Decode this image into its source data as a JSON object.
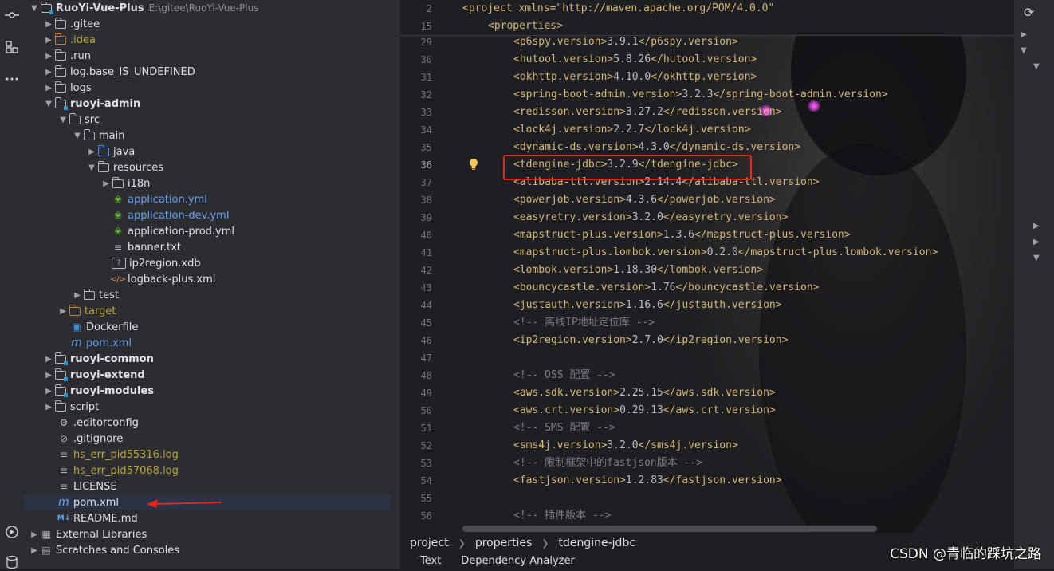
{
  "project": {
    "root_name": "RuoYi-Vue-Plus",
    "root_path": "E:\\gitee\\RuoYi-Vue-Plus",
    "rows": [
      {
        "label": "RuoYi-Vue-Plus",
        "kind": "root"
      },
      {
        "label": ".gitee"
      },
      {
        "label": ".idea"
      },
      {
        "label": ".run"
      },
      {
        "label": "log.base_IS_UNDEFINED"
      },
      {
        "label": "logs"
      },
      {
        "label": "ruoyi-admin"
      },
      {
        "label": "src"
      },
      {
        "label": "main"
      },
      {
        "label": "java"
      },
      {
        "label": "resources"
      },
      {
        "label": "i18n"
      },
      {
        "label": "application.yml"
      },
      {
        "label": "application-dev.yml"
      },
      {
        "label": "application-prod.yml"
      },
      {
        "label": "banner.txt"
      },
      {
        "label": "ip2region.xdb"
      },
      {
        "label": "logback-plus.xml"
      },
      {
        "label": "test"
      },
      {
        "label": "target"
      },
      {
        "label": "Dockerfile"
      },
      {
        "label": "pom.xml"
      },
      {
        "label": "ruoyi-common"
      },
      {
        "label": "ruoyi-extend"
      },
      {
        "label": "ruoyi-modules"
      },
      {
        "label": "script"
      },
      {
        "label": ".editorconfig"
      },
      {
        "label": ".gitignore"
      },
      {
        "label": "hs_err_pid55316.log"
      },
      {
        "label": "hs_err_pid57068.log"
      },
      {
        "label": "LICENSE"
      },
      {
        "label": "pom.xml"
      },
      {
        "label": "README.md"
      },
      {
        "label": "External Libraries"
      },
      {
        "label": "Scratches and Consoles"
      }
    ]
  },
  "editor": {
    "sticky": [
      {
        "line": "2",
        "text": "<project xmlns=\"http://maven.apache.org/POM/4.0.0\""
      },
      {
        "line": "15",
        "text": "<properties>"
      }
    ],
    "lines": [
      {
        "n": "29",
        "pre": "<",
        "tag": "p6spy.version",
        "val": "3.9.1"
      },
      {
        "n": "30",
        "tag": "hutool.version",
        "val": "5.8.26"
      },
      {
        "n": "31",
        "tag": "okhttp.version",
        "val": "4.10.0"
      },
      {
        "n": "32",
        "tag": "spring-boot-admin.version",
        "val": "3.2.3"
      },
      {
        "n": "33",
        "tag": "redisson.version",
        "val": "3.27.2"
      },
      {
        "n": "34",
        "tag": "lock4j.version",
        "val": "2.2.7"
      },
      {
        "n": "35",
        "tag": "dynamic-ds.version",
        "val": "4.3.0"
      },
      {
        "n": "36",
        "tag": "tdengine-jdbc",
        "val": "3.2.9"
      },
      {
        "n": "37",
        "tag": "alibaba-ttl.version",
        "val": "2.14.4"
      },
      {
        "n": "38",
        "tag": "powerjob.version",
        "val": "4.3.6"
      },
      {
        "n": "39",
        "tag": "easyretry.version",
        "val": "3.2.0"
      },
      {
        "n": "40",
        "tag": "mapstruct-plus.version",
        "val": "1.3.6"
      },
      {
        "n": "41",
        "tag": "mapstruct-plus.lombok.version",
        "val": "0.2.0"
      },
      {
        "n": "42",
        "tag": "lombok.version",
        "val": "1.18.30"
      },
      {
        "n": "43",
        "tag": "bouncycastle.version",
        "val": "1.76"
      },
      {
        "n": "44",
        "tag": "justauth.version",
        "val": "1.16.6"
      },
      {
        "n": "45",
        "comment": "<!-- 离线IP地址定位库 -->"
      },
      {
        "n": "46",
        "tag": "ip2region.version",
        "val": "2.7.0"
      },
      {
        "n": "47",
        "blank": true
      },
      {
        "n": "48",
        "comment": "<!-- OSS 配置 -->"
      },
      {
        "n": "49",
        "tag": "aws.sdk.version",
        "val": "2.25.15"
      },
      {
        "n": "50",
        "tag": "aws.crt.version",
        "val": "0.29.13"
      },
      {
        "n": "51",
        "comment": "<!-- SMS 配置 -->"
      },
      {
        "n": "52",
        "tag": "sms4j.version",
        "val": "3.2.0"
      },
      {
        "n": "53",
        "comment": "<!-- 限制框架中的fastjson版本 -->"
      },
      {
        "n": "54",
        "tag": "fastjson.version",
        "val": "1.2.83"
      },
      {
        "n": "55",
        "blank": true
      },
      {
        "n": "56",
        "comment": "<!-- 插件版本 -->"
      }
    ],
    "inspections_count": "5"
  },
  "breadcrumbs": [
    "project",
    "properties",
    "tdengine-jdbc"
  ],
  "bottom_tabs": [
    "Text",
    "Dependency Analyzer"
  ],
  "watermark": "CSDN @青临的踩坑之路",
  "colors": {
    "highlight_box": "#e0281c",
    "arrow": "#e0281c"
  }
}
